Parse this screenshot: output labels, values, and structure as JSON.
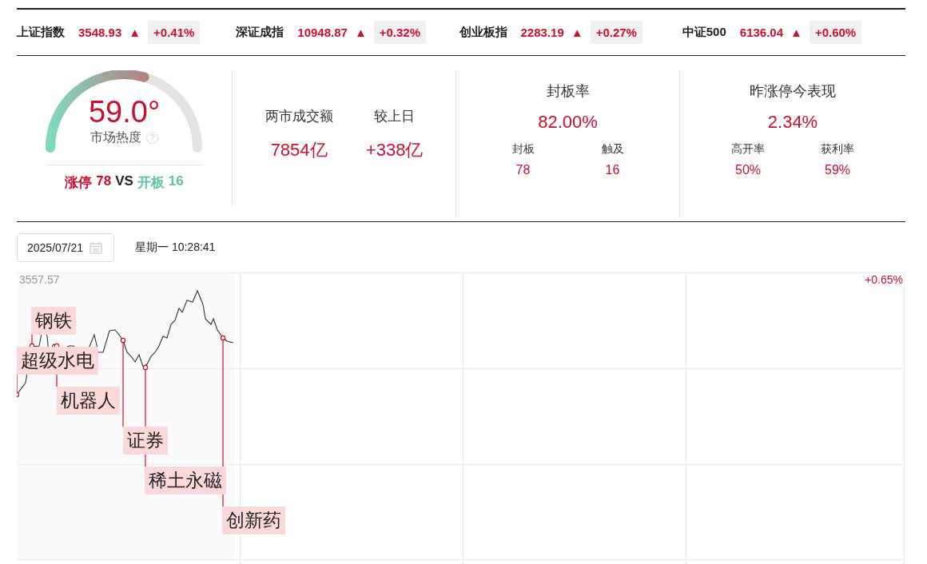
{
  "indices": [
    {
      "name": "上证指数",
      "value": "3548.93",
      "arrow": "▲",
      "change": "+0.41%"
    },
    {
      "name": "深证成指",
      "value": "10948.87",
      "arrow": "▲",
      "change": "+0.32%"
    },
    {
      "name": "创业板指",
      "value": "2283.19",
      "arrow": "▲",
      "change": "+0.27%"
    },
    {
      "name": "中证500",
      "value": "6136.04",
      "arrow": "▲",
      "change": "+0.60%"
    }
  ],
  "heat": {
    "value": "59.0°",
    "label": "市场热度",
    "help": "?",
    "limit_up": {
      "label": "涨停",
      "value": "78"
    },
    "vs": "VS",
    "opened": {
      "label": "开板",
      "value": "16"
    }
  },
  "turnover": [
    {
      "label": "两市成交额",
      "value": "7854亿"
    },
    {
      "label": "较上日",
      "value": "+338亿"
    }
  ],
  "seal_rate": {
    "title": "封板率",
    "value": "82.00%",
    "stats": [
      {
        "label": "封板",
        "value": "78"
      },
      {
        "label": "触及",
        "value": "16"
      }
    ]
  },
  "yesterday": {
    "title": "昨涨停今表现",
    "value": "2.34%",
    "stats": [
      {
        "label": "高开率",
        "value": "50%"
      },
      {
        "label": "获利率",
        "value": "59%"
      }
    ]
  },
  "date": {
    "value": "2025/07/21",
    "time": "星期一 10:28:41"
  },
  "chart": {
    "top_value": "3557.57",
    "top_change": "+0.65%",
    "annotations": [
      {
        "label": "钢铁"
      },
      {
        "label": "超级水电"
      },
      {
        "label": "机器人"
      },
      {
        "label": "证券"
      },
      {
        "label": "稀土永磁"
      },
      {
        "label": "创新药"
      }
    ]
  }
}
